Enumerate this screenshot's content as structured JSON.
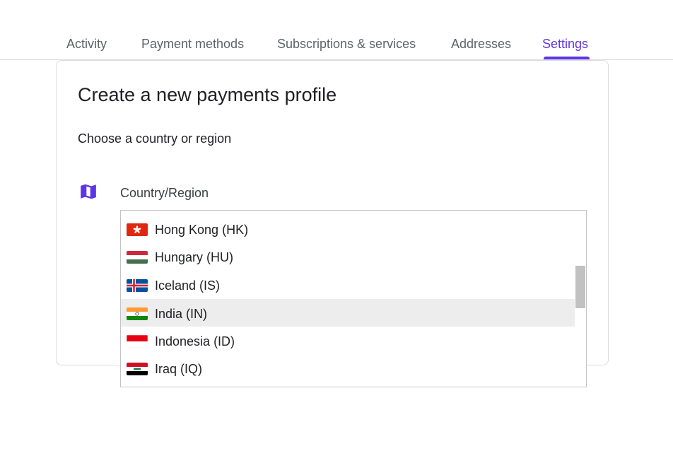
{
  "tabs": [
    {
      "label": "Activity"
    },
    {
      "label": "Payment methods"
    },
    {
      "label": "Subscriptions & services"
    },
    {
      "label": "Addresses"
    },
    {
      "label": "Settings",
      "active": true
    }
  ],
  "card": {
    "title": "Create a new payments profile",
    "subtitle": "Choose a country or region",
    "field_icon": "map-icon",
    "field_label": "Country/Region"
  },
  "dropdown": {
    "options": [
      {
        "label": "Hong Kong (HK)",
        "flag": "hong-kong-flag"
      },
      {
        "label": "Hungary (HU)",
        "flag": "hungary-flag"
      },
      {
        "label": "Iceland (IS)",
        "flag": "iceland-flag"
      },
      {
        "label": "India (IN)",
        "flag": "india-flag",
        "highlighted": true
      },
      {
        "label": "Indonesia (ID)",
        "flag": "indonesia-flag"
      },
      {
        "label": "Iraq (IQ)",
        "flag": "iraq-flag"
      }
    ]
  },
  "colors": {
    "accent": "#5e35e6",
    "text": "#202124",
    "muted": "#5f6368",
    "highlight": "#ededed",
    "border": "#dadce0"
  }
}
